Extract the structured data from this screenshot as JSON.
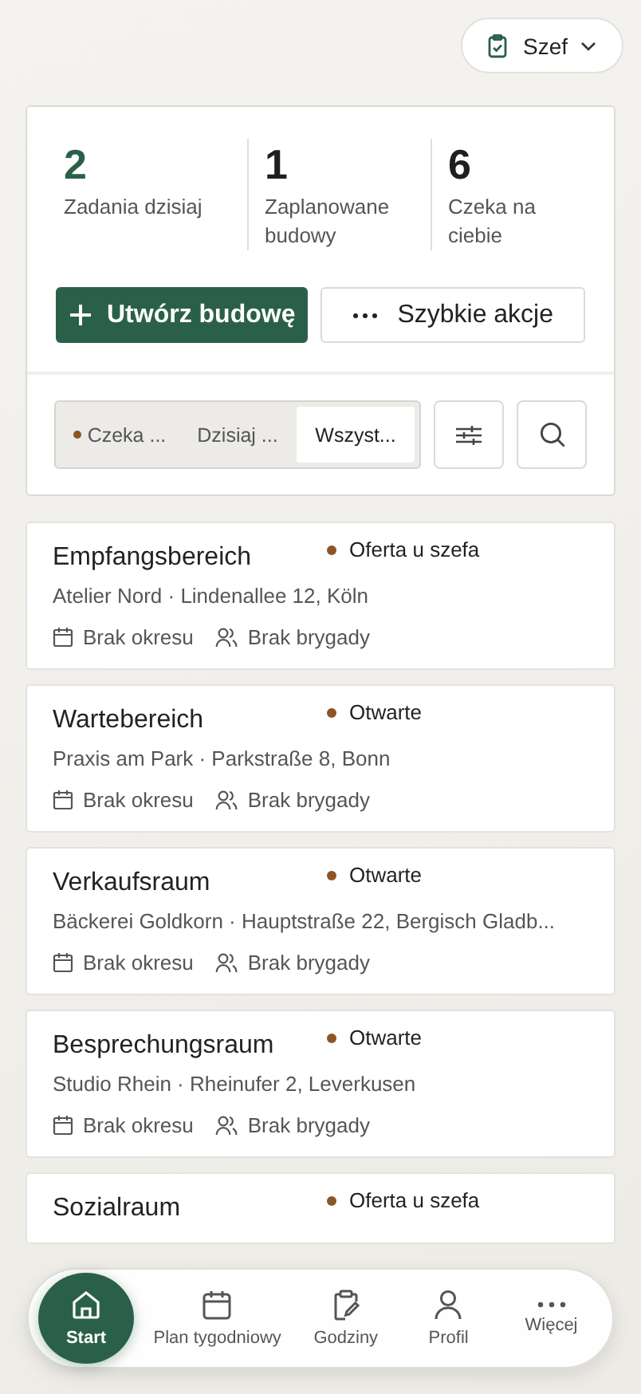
{
  "role_menu": {
    "label": "Szef"
  },
  "stats": [
    {
      "value": "2",
      "label": "Zadania dzisiaj",
      "accent": true
    },
    {
      "value": "1",
      "label": "Zaplanowane budowy",
      "accent": false
    },
    {
      "value": "6",
      "label": "Czeka na ciebie",
      "accent": false
    }
  ],
  "actions": {
    "primary": "Utwórz budowę",
    "secondary": "Szybkie akcje"
  },
  "filters": [
    {
      "label": "Czeka ...",
      "dot": true,
      "selected": false
    },
    {
      "label": "Dzisiaj ...",
      "dot": false,
      "selected": false
    },
    {
      "label": "Wszyst...",
      "dot": false,
      "selected": true
    }
  ],
  "jobs": [
    {
      "title": "Empfangsbereich",
      "status": "Oferta u szefa",
      "address": "Atelier Nord · Lindenallee 12, Köln",
      "period": "Brak okresu",
      "crew": "Brak brygady"
    },
    {
      "title": "Wartebereich",
      "status": "Otwarte",
      "address": "Praxis am Park · Parkstraße 8, Bonn",
      "period": "Brak okresu",
      "crew": "Brak brygady"
    },
    {
      "title": "Verkaufsraum",
      "status": "Otwarte",
      "address": "Bäckerei Goldkorn · Hauptstraße 22, Bergisch Gladb...",
      "period": "Brak okresu",
      "crew": "Brak brygady"
    },
    {
      "title": "Besprechungsraum",
      "status": "Otwarte",
      "address": "Studio Rhein · Rheinufer 2, Leverkusen",
      "period": "Brak okresu",
      "crew": "Brak brygady"
    },
    {
      "title": "Sozialraum",
      "status": "Oferta u szefa"
    }
  ],
  "nav": [
    {
      "label": "Start",
      "selected": true
    },
    {
      "label": "Plan tygodniowy",
      "selected": false
    },
    {
      "label": "Godziny",
      "selected": false
    },
    {
      "label": "Profil",
      "selected": false
    },
    {
      "label": "Więcej",
      "selected": false
    }
  ]
}
